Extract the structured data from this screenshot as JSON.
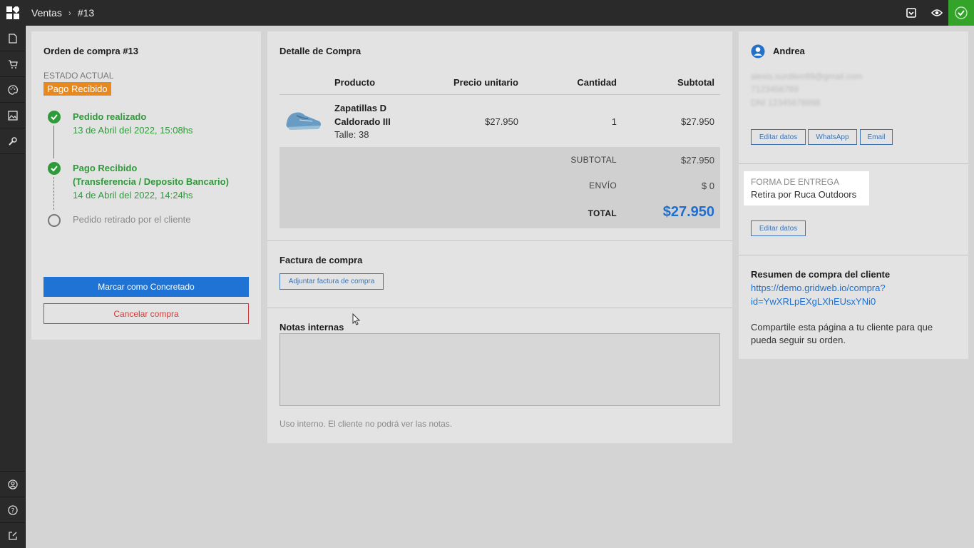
{
  "breadcrumb": {
    "section": "Ventas",
    "order": "#13"
  },
  "left": {
    "title": "Orden de compra #13",
    "estado_label": "ESTADO ACTUAL",
    "estado_value": "Pago Recibido",
    "timeline": {
      "step1_title": "Pedido realizado",
      "step1_date": "13 de Abril del 2022, 15:08hs",
      "step2_title_l1": "Pago Recibido",
      "step2_title_l2": "(Transferencia / Deposito Bancario)",
      "step2_date": "14 de Abril del 2022, 14:24hs",
      "step3_title": "Pedido retirado por el cliente"
    },
    "btn_concretado": "Marcar como Concretado",
    "btn_cancelar": "Cancelar compra"
  },
  "middle": {
    "title": "Detalle de Compra",
    "columns": {
      "producto": "Producto",
      "precio": "Precio unitario",
      "cantidad": "Cantidad",
      "subtotal": "Subtotal"
    },
    "item": {
      "name_l1": "Zapatillas D",
      "name_l2": "Caldorado III",
      "variant": "Talle: 38",
      "price": "$27.950",
      "qty": "1",
      "subtotal": "$27.950"
    },
    "totals": {
      "subtotal_label": "SUBTOTAL",
      "subtotal_value": "$27.950",
      "envio_label": "ENVÍO",
      "envio_value": "$ 0",
      "total_label": "TOTAL",
      "total_value": "$27.950"
    },
    "factura_title": "Factura de compra",
    "factura_btn": "Adjuntar factura de compra",
    "notas_title": "Notas internas",
    "notas_value": "",
    "notas_hint": "Uso interno. El cliente no podrá ver las notas."
  },
  "right": {
    "customer_name": "Andrea",
    "email": "alexis.surdileo99@gmail.com",
    "phone": "7123456789",
    "dni": "DNI 12345678998",
    "btn_editar": "Editar datos",
    "btn_whatsapp": "WhatsApp",
    "btn_email": "Email",
    "entrega_label": "FORMA DE ENTREGA",
    "entrega_value": "Retira por Ruca Outdoors",
    "btn_editar2": "Editar datos",
    "resumen_title": "Resumen de compra del cliente",
    "resumen_link_l1": "https://demo.gridweb.io/compra?",
    "resumen_link_l2": "id=YwXRLpEXgLXhEUsxYNi0",
    "resumen_text_l1": "Compartile esta página a tu cliente para que",
    "resumen_text_l2": "pueda seguir su orden."
  },
  "colors": {
    "accent": "#1f73d4",
    "success": "#2f9a3a",
    "warning": "#e8891f",
    "danger": "#d23b3b"
  }
}
